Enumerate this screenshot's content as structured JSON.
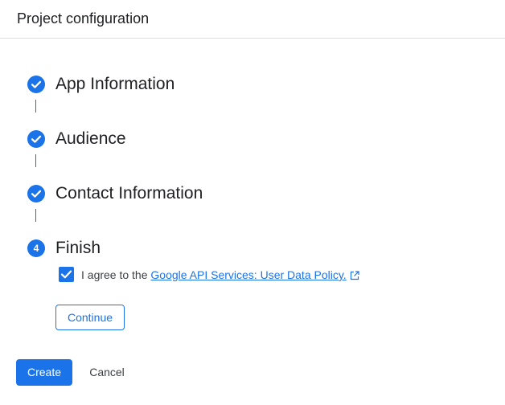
{
  "header": {
    "title": "Project configuration"
  },
  "steps": [
    {
      "label": "App Information",
      "status": "complete",
      "icon": "check-circle-icon"
    },
    {
      "label": "Audience",
      "status": "complete",
      "icon": "check-circle-icon"
    },
    {
      "label": "Contact Information",
      "status": "complete",
      "icon": "check-circle-icon"
    },
    {
      "label": "Finish",
      "status": "current",
      "number": "4"
    }
  ],
  "agreement": {
    "checked": true,
    "prefix": "I agree to the ",
    "link_text": "Google API Services: User Data Policy.",
    "link_icon": "open-in-new-icon"
  },
  "buttons": {
    "continue": "Continue",
    "create": "Create",
    "cancel": "Cancel"
  },
  "colors": {
    "accent": "#1a73e8",
    "text": "#202124",
    "divider": "#dadce0"
  }
}
